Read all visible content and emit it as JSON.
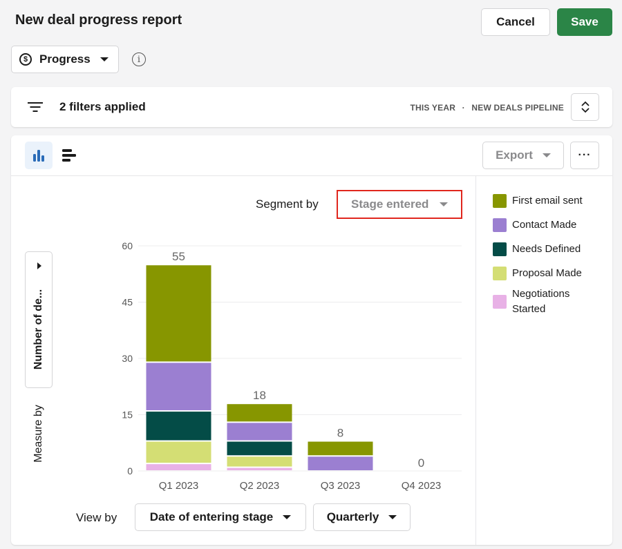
{
  "header": {
    "title": "New deal progress report",
    "cancel_label": "Cancel",
    "save_label": "Save"
  },
  "report_type": {
    "icon": "dollar-circle-icon",
    "label": "Progress",
    "info_icon": "info-icon"
  },
  "filters": {
    "label": "2 filters applied",
    "period": "THIS YEAR",
    "separator": "·",
    "pipeline": "NEW DEALS PIPELINE"
  },
  "toolbar": {
    "view_column_icon": "bar-chart-icon",
    "view_bar_icon": "horizontal-bar-chart-icon",
    "export_label": "Export",
    "more_label": "···"
  },
  "segment": {
    "label": "Segment by",
    "value": "Stage entered"
  },
  "measure": {
    "label": "Measure by",
    "value": "Number of de..."
  },
  "view_by": {
    "label": "View by",
    "value": "Date of entering stage",
    "interval": "Quarterly"
  },
  "colors": {
    "accent_save": "#2b8547",
    "highlight_border": "#e0261d"
  },
  "chart_data": {
    "type": "bar",
    "stacked": true,
    "title": "",
    "xlabel": "",
    "ylabel": "",
    "ylim": [
      0,
      60
    ],
    "yticks": [
      0,
      15,
      30,
      45,
      60
    ],
    "grid": true,
    "legend_position": "right",
    "categories": [
      "Q1 2023",
      "Q2 2023",
      "Q3 2023",
      "Q4 2023"
    ],
    "totals": [
      55,
      18,
      8,
      0
    ],
    "series": [
      {
        "name": "Negotiations Started",
        "color": "#e8b1e6",
        "values": [
          2,
          1,
          0,
          0
        ]
      },
      {
        "name": "Proposal Made",
        "color": "#d4de74",
        "values": [
          6,
          3,
          0,
          0
        ]
      },
      {
        "name": "Needs Defined",
        "color": "#044c47",
        "values": [
          8,
          4,
          0,
          0
        ]
      },
      {
        "name": "Contact Made",
        "color": "#9b7fd1",
        "values": [
          13,
          5,
          4,
          0
        ]
      },
      {
        "name": "First email sent",
        "color": "#879600",
        "values": [
          26,
          5,
          4,
          0
        ]
      }
    ],
    "legend_order": [
      "First email sent",
      "Contact Made",
      "Needs Defined",
      "Proposal Made",
      "Negotiations Started"
    ]
  }
}
